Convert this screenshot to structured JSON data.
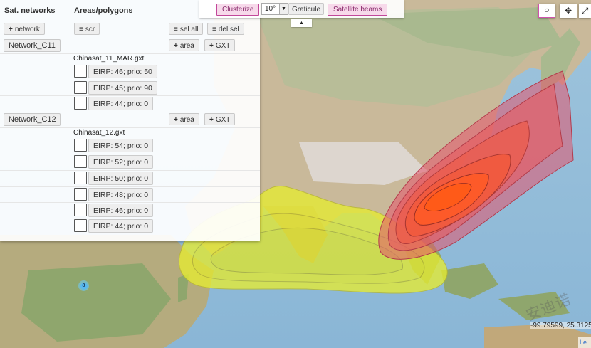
{
  "panel": {
    "sat_networks_header": "Sat. networks",
    "areas_header": "Areas/polygons",
    "add_network_label": "network",
    "scr_label": "scr",
    "sel_all_label": "sel all",
    "del_sel_label": "del sel",
    "networks": [
      {
        "name": "Network_C11",
        "area_label": "area",
        "gxt_label": "GXT",
        "file": "Chinasat_11_MAR.gxt",
        "beams": [
          "EIRP: 46; prio: 50",
          "EIRP: 45; prio: 90",
          "EIRP: 44; prio: 0"
        ]
      },
      {
        "name": "Network_C12",
        "area_label": "area",
        "gxt_label": "GXT",
        "file": "Chinasat_12.gxt",
        "beams": [
          "EIRP: 54; prio: 0",
          "EIRP: 52; prio: 0",
          "EIRP: 50; prio: 0",
          "EIRP: 48; prio: 0",
          "EIRP: 46; prio: 0",
          "EIRP: 44; prio: 0"
        ]
      }
    ]
  },
  "toolbar": {
    "clusterize_label": "Clusterize",
    "graticule_value": "10°",
    "graticule_label": "Graticule",
    "satellite_beams_label": "Satellite beams",
    "toggle_glyph": "▲"
  },
  "map": {
    "cluster_count": "8",
    "coordinates": "-99.79599, 25.3125",
    "attribution": "Le",
    "watermark": "安迪诺",
    "beam_colors": {
      "yellow": "#e6ec32",
      "red_outer": "#e4546b",
      "red_inner": "#ff5a26"
    },
    "controls": [
      {
        "name": "draw-circle",
        "glyph": "○"
      },
      {
        "name": "pan",
        "glyph": "✥"
      },
      {
        "name": "fullscreen",
        "glyph": "⤢"
      }
    ]
  }
}
